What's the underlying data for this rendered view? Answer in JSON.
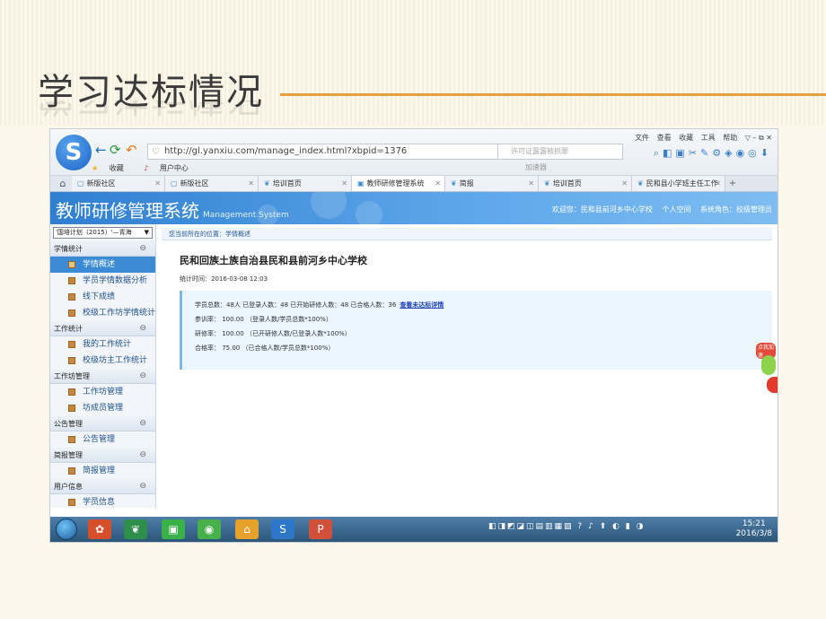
{
  "slide": {
    "title": "学习达标情况"
  },
  "browser": {
    "url": "http://gl.yanxiu.com/manage_index.html?xbpid=1376",
    "accelerate": "加速器",
    "search_placeholder": "许可证露露被抓罪",
    "menu": [
      "文件",
      "查看",
      "收藏",
      "工具",
      "帮助"
    ],
    "favorites": [
      "收藏",
      "用户中心"
    ],
    "tabs": [
      {
        "label": "新版社区",
        "active": false
      },
      {
        "label": "新版社区",
        "active": false
      },
      {
        "label": "培训首页",
        "active": false
      },
      {
        "label": "教师研修管理系统",
        "active": true
      },
      {
        "label": "简报",
        "active": false
      },
      {
        "label": "培训首页",
        "active": false
      },
      {
        "label": "民和县小学班主任工作",
        "active": false
      }
    ]
  },
  "app": {
    "title": "教师研修管理系统",
    "subtitle": "Management System",
    "welcome": "欢迎您：民和县前河乡中心学校",
    "personal_space": "个人空间",
    "role": "系统角色：校级管理员"
  },
  "sidebar": {
    "plan": "'国培计划（2015）'—青海",
    "groups": [
      {
        "label": "学情统计",
        "items": [
          "学情概述",
          "学员学情数据分析",
          "线下成绩",
          "校级工作坊学情统计"
        ]
      },
      {
        "label": "工作统计",
        "items": [
          "我的工作统计",
          "校级坊主工作统计"
        ]
      },
      {
        "label": "工作坊管理",
        "items": [
          "工作坊管理",
          "坊成员管理"
        ]
      },
      {
        "label": "公告管理",
        "items": [
          "公告管理"
        ]
      },
      {
        "label": "简报管理",
        "items": [
          "简报管理"
        ]
      },
      {
        "label": "用户信息",
        "items": [
          "学员信息"
        ]
      }
    ]
  },
  "main": {
    "breadcrumb": "您当前所在的位置：学情概述",
    "school": "民和回族土族自治县民和县前河乡中心学校",
    "stat_time": "统计时间：2016-03-08 12:03",
    "summary": "学员总数：48人  已登录人数：48  已开始研修人数：48  已合格人数：36",
    "detail_link": "查看未达标详情",
    "participation": "参训率： 100.00 （登录人数/学员总数*100%）",
    "study_rate": "研修率： 100.00 （已开研修人数/已登录人数*100%）",
    "pass_rate": "合格率： 75.00 （已合格人数/学员总数*100%）"
  },
  "widget": {
    "badge": "点我加速"
  },
  "taskbar": {
    "time": "15:21",
    "date": "2016/3/8"
  }
}
